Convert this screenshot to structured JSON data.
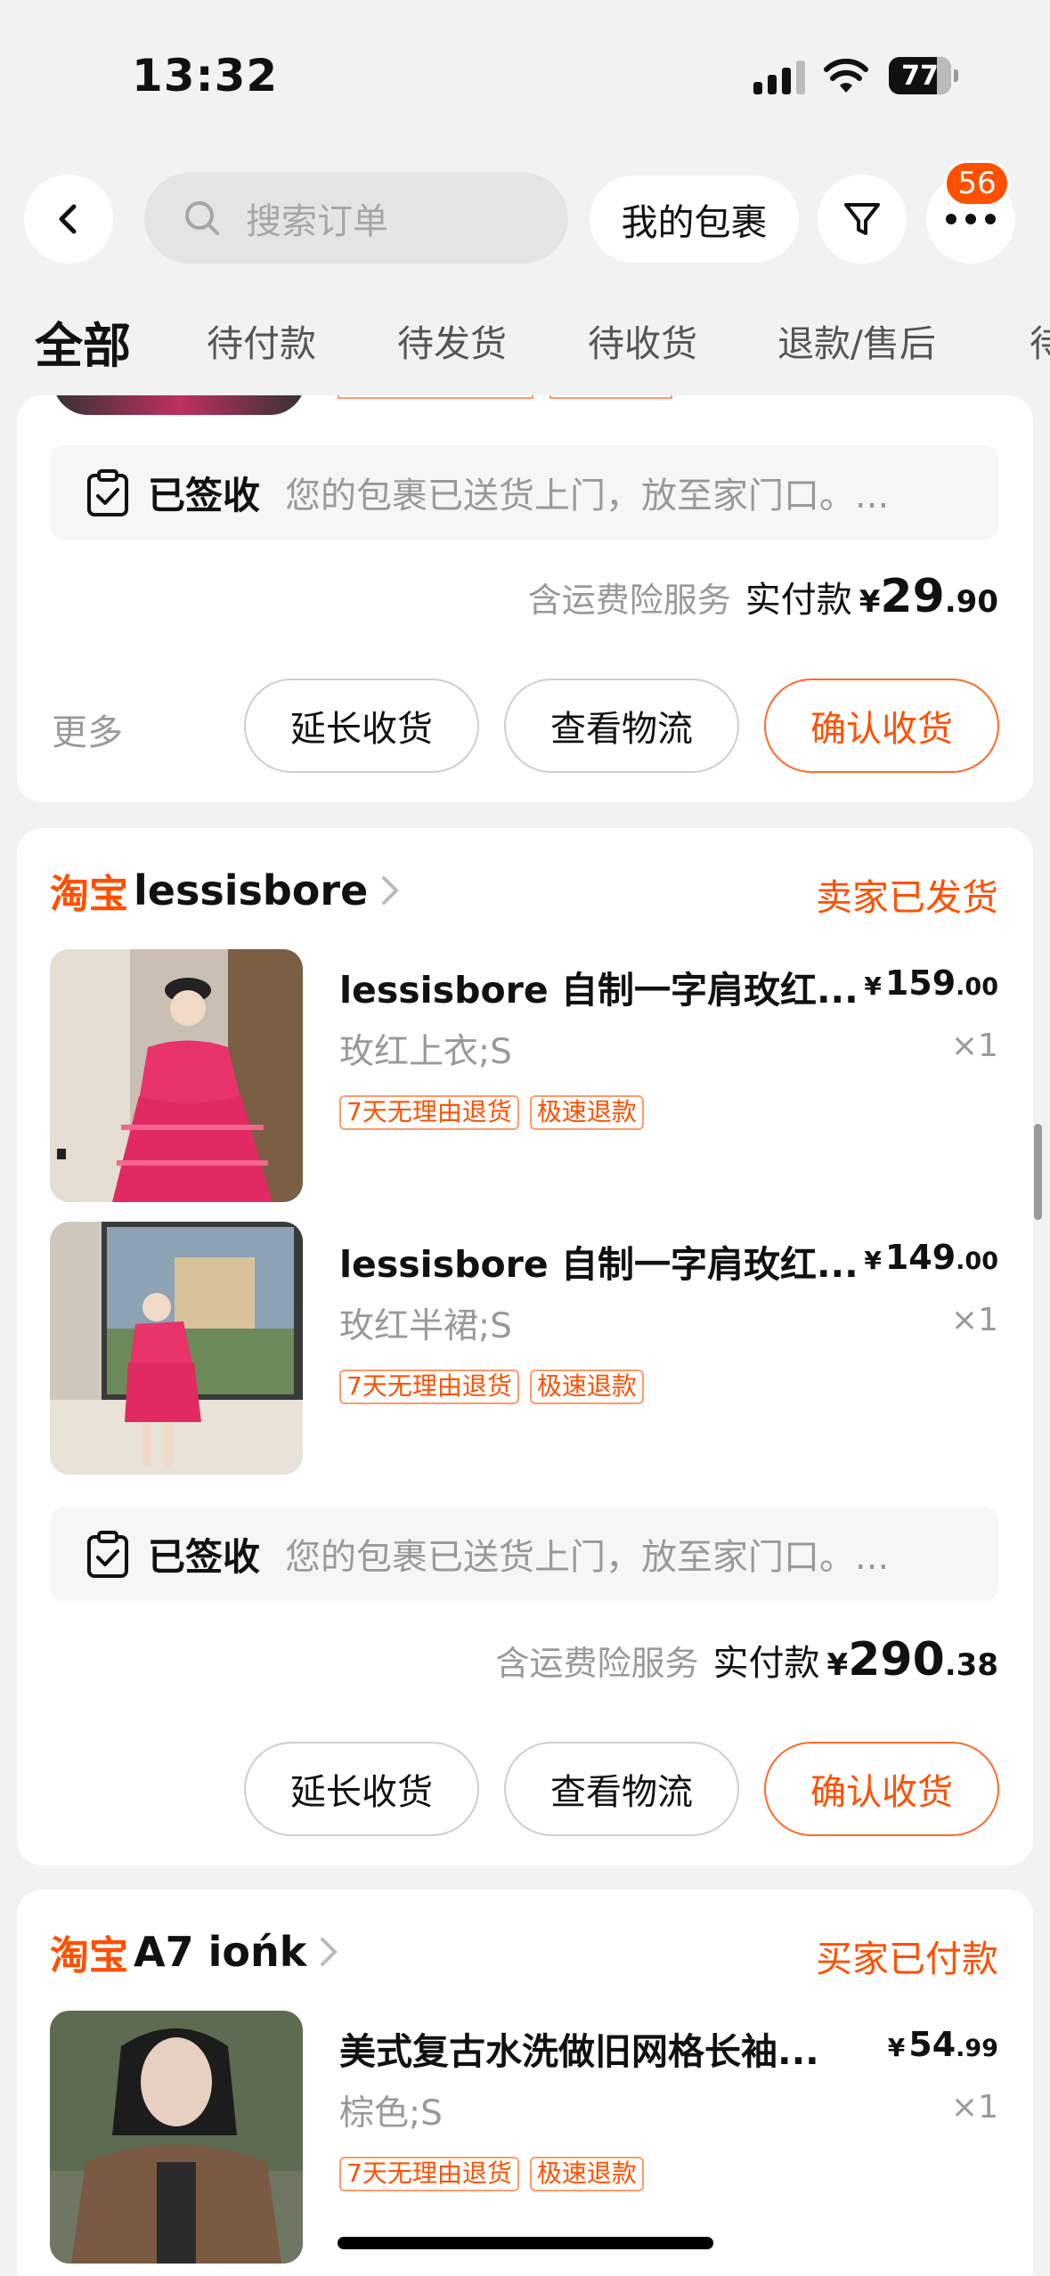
{
  "status_bar": {
    "time": "13:32",
    "battery": "77"
  },
  "header": {
    "search_placeholder": "搜索订单",
    "package_label": "我的包裹",
    "more_badge": "56"
  },
  "tabs": [
    {
      "label": "全部",
      "active": true
    },
    {
      "label": "待付款"
    },
    {
      "label": "待发货"
    },
    {
      "label": "待收货"
    },
    {
      "label": "退款/售后"
    },
    {
      "label": "待"
    }
  ],
  "orders": [
    {
      "logistics": {
        "title": "已签收",
        "desc": "您的包裹已送货上门，放至家门口。..."
      },
      "payment": {
        "insurance": "含运费险服务",
        "label": "实付款",
        "currency": "¥",
        "int": "29",
        "dec": ".90"
      },
      "more_label": "更多",
      "buttons": {
        "extend": "延长收货",
        "track": "查看物流",
        "confirm": "确认收货"
      }
    },
    {
      "platform": "淘宝",
      "shop": "lessisbore",
      "status": "卖家已发货",
      "items": [
        {
          "title": "lessisbore 自制一字肩玫红...",
          "price_currency": "¥",
          "price_int": "159",
          "price_dec": ".00",
          "spec": "玫红上衣;S",
          "qty": "×1",
          "tags": [
            "7天无理由退货",
            "极速退款"
          ]
        },
        {
          "title": "lessisbore 自制一字肩玫红...",
          "price_currency": "¥",
          "price_int": "149",
          "price_dec": ".00",
          "spec": "玫红半裙;S",
          "qty": "×1",
          "tags": [
            "7天无理由退货",
            "极速退款"
          ]
        }
      ],
      "logistics": {
        "title": "已签收",
        "desc": "您的包裹已送货上门，放至家门口。..."
      },
      "payment": {
        "insurance": "含运费险服务",
        "label": "实付款",
        "currency": "¥",
        "int": "290",
        "dec": ".38"
      },
      "buttons": {
        "extend": "延长收货",
        "track": "查看物流",
        "confirm": "确认收货"
      }
    },
    {
      "platform": "淘宝",
      "shop": "A7 iońk",
      "status": "买家已付款",
      "items": [
        {
          "title": "美式复古水洗做旧网格长袖...",
          "price_currency": "¥",
          "price_int": "54",
          "price_dec": ".99",
          "spec": "棕色;S",
          "qty": "×1",
          "tags": [
            "7天无理由退货",
            "极速退款"
          ]
        }
      ]
    }
  ],
  "colors": {
    "accent": "#ff5000",
    "background": "#f2f2f2"
  }
}
